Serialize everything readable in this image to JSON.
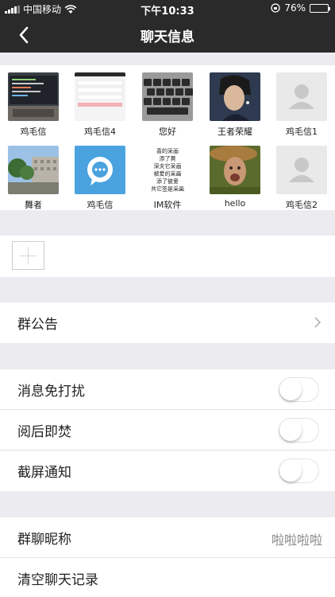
{
  "status_bar": {
    "carrier": "中国移动",
    "time": "下午10:33",
    "battery": "76%",
    "battery_level": 0.76
  },
  "nav": {
    "title": "聊天信息"
  },
  "members": [
    {
      "name": "鸡毛信",
      "avatar": "laptop-code-photo"
    },
    {
      "name": "鸡毛信4",
      "avatar": "app-screenshot"
    },
    {
      "name": "您好",
      "avatar": "keyboard-photo"
    },
    {
      "name": "王者荣耀",
      "avatar": "person-photo"
    },
    {
      "name": "鸡毛信1",
      "avatar": "default-avatar"
    },
    {
      "name": "舞者",
      "avatar": "building-photo"
    },
    {
      "name": "鸡毛信",
      "avatar": "chat-app-logo"
    },
    {
      "name": "IM软件",
      "avatar": "calligraphy-image"
    },
    {
      "name": "hello",
      "avatar": "meme-photo"
    },
    {
      "name": "鸡毛信2",
      "avatar": "default-avatar"
    }
  ],
  "calligraphy_lines": [
    "喜的采画",
    "添了黄",
    "深夫它采画",
    "被爱的采画",
    "添了彼爱",
    "共它签是采画"
  ],
  "settings": {
    "announcement": {
      "label": "群公告"
    },
    "mute": {
      "label": "消息免打扰",
      "on": false
    },
    "burn_after_reading": {
      "label": "阅后即焚",
      "on": false
    },
    "screenshot_notify": {
      "label": "截屏通知",
      "on": false
    },
    "group_nickname": {
      "label": "群聊昵称",
      "value": "啦啦啦啦"
    },
    "clear_history": {
      "label": "清空聊天记录"
    }
  },
  "colors": {
    "nav_bg": "#2a2a2a",
    "page_bg": "#ececf0",
    "accent_blue": "#4aa3df"
  }
}
